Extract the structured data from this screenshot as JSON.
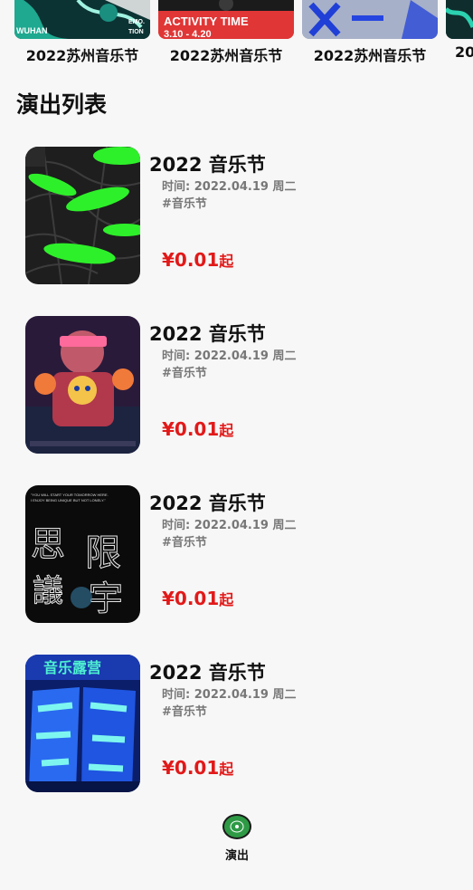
{
  "carousel": {
    "items": [
      {
        "label": "2022苏州音乐节",
        "poster_text": [
          "WUHAN",
          "EMO.",
          "TION"
        ]
      },
      {
        "label": "2022苏州音乐节",
        "poster_text": [
          "ACTIVITY TIME",
          "3.10 - 4.20"
        ]
      },
      {
        "label": "2022苏州音乐节",
        "poster_text": []
      },
      {
        "label": "20",
        "poster_text": []
      }
    ]
  },
  "section_title": "演出列表",
  "shows": [
    {
      "name": "2022 音乐节",
      "time": "时间: 2022.04.19 周二",
      "tag": "#音乐节",
      "price": "¥0.01",
      "price_suffix": "起",
      "poster_icon": "green-abstract-poster"
    },
    {
      "name": "2022 音乐节",
      "time": "时间: 2022.04.19 周二",
      "tag": "#音乐节",
      "price": "¥0.01",
      "price_suffix": "起",
      "poster_icon": "pixel-character-poster"
    },
    {
      "name": "2022 音乐节",
      "time": "时间: 2022.04.19 周二",
      "tag": "#音乐节",
      "price": "¥0.01",
      "price_suffix": "起",
      "poster_icon": "black-typography-poster",
      "poster_text": [
        "\"YOU WILL START YOUR TOMORROW HERE.",
        "I ENJOY BEING UNIQUE BUT NOT LONELY.\"",
        "思",
        "限",
        "議",
        "宇"
      ]
    },
    {
      "name": "2022 音乐节",
      "time": "时间: 2022.04.19 周二",
      "tag": "#音乐节",
      "price": "¥0.01",
      "price_suffix": "起",
      "poster_icon": "blue-neon-poster",
      "poster_text": [
        "音乐露营"
      ]
    }
  ],
  "tabbar": {
    "items": [
      {
        "label": "演出",
        "icon": "vinyl-record-icon",
        "active": true
      }
    ]
  },
  "colors": {
    "price": "#e21919",
    "accent_green": "#2e9a45",
    "background": "#f7f7f7"
  }
}
